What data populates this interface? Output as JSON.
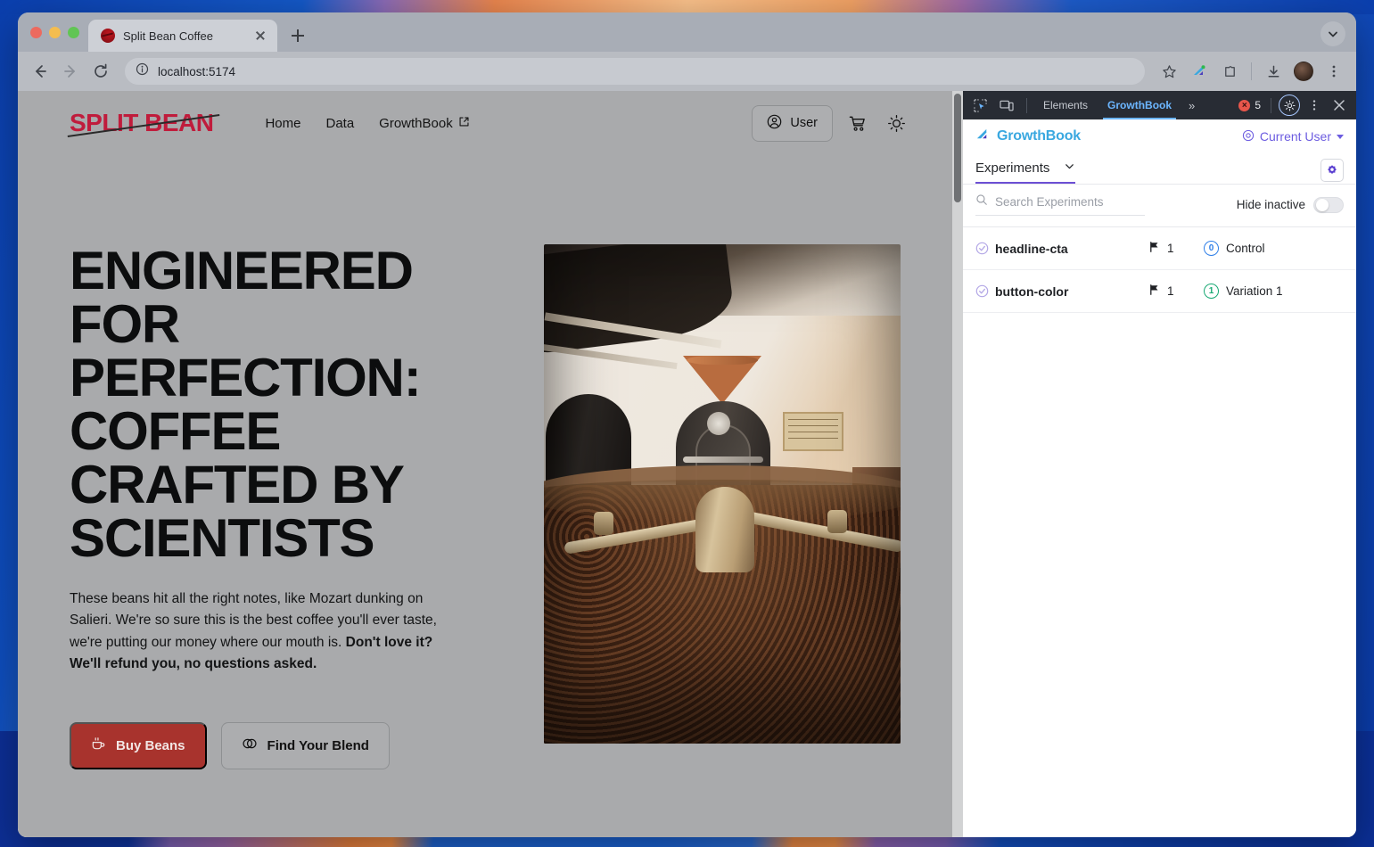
{
  "browser": {
    "tab": {
      "title": "Split Bean Coffee",
      "favicon": "split-bean-logo-icon",
      "close": "×"
    },
    "new_tab_label": "+",
    "url": "localhost:5174",
    "toolbar_icons": [
      "back-icon",
      "forward-icon",
      "reload-icon",
      "site-info-icon",
      "bookmark-star-icon",
      "growthbook-extension-icon",
      "extensions-puzzle-icon",
      "downloads-icon",
      "profile-avatar",
      "chrome-menu-icon"
    ]
  },
  "page": {
    "logo": "SPLIT BEAN",
    "nav": [
      {
        "label": "Home",
        "external": false
      },
      {
        "label": "Data",
        "external": false
      },
      {
        "label": "GrowthBook",
        "external": true
      }
    ],
    "user_button": "User",
    "cart_icon": "shopping-cart-icon",
    "theme_icon": "sun-icon",
    "hero": {
      "headline": "ENGINEERED FOR PERFECTION: COFFEE CRAFTED BY SCIENTISTS",
      "body_plain": "These beans hit all the right notes, like Mozart dunking on Salieri. We're so sure this is the best coffee you'll ever taste, we're putting our money where our mouth is. ",
      "body_bold": "Don't love it? We'll refund you, no questions asked.",
      "primary_cta": "Buy Beans",
      "secondary_cta": "Find Your Blend",
      "image_alt": "coffee-roastery-roaster-and-beans"
    }
  },
  "devtools": {
    "tabs": [
      {
        "label": "Elements",
        "active": false
      },
      {
        "label": "GrowthBook",
        "active": true
      }
    ],
    "overflow": "»",
    "error_count": "5",
    "icons": [
      "inspect-element-icon",
      "device-toolbar-icon",
      "settings-gear-icon",
      "kebab-menu-icon",
      "close-icon"
    ]
  },
  "growthbook": {
    "brand": "GrowthBook",
    "current_user": "Current User",
    "panel_tab": "Experiments",
    "search_placeholder": "Search Experiments",
    "hide_inactive_label": "Hide inactive",
    "hide_inactive_on": false,
    "experiments": [
      {
        "name": "headline-cta",
        "flags": "1",
        "variation_index": "0",
        "variation_label": "Control",
        "variation_color": "#2f7fe8"
      },
      {
        "name": "button-color",
        "flags": "1",
        "variation_index": "1",
        "variation_label": "Variation 1",
        "variation_color": "#19a974"
      }
    ]
  },
  "colors": {
    "brand_red": "#c01c3c",
    "cta_red": "#a8332d",
    "growthbook_blue": "#3aa8e0",
    "growthbook_purple": "#6c4fd4",
    "devtools_bg": "#282c34",
    "devtools_tab_active": "#6cb6ff"
  }
}
